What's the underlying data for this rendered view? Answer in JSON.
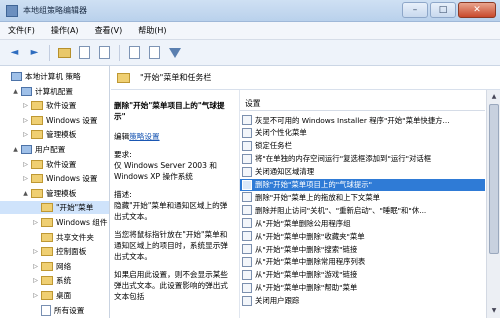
{
  "window": {
    "title": "本地组策略编辑器",
    "min": "–",
    "max": "□",
    "close": "✕"
  },
  "menu": [
    "文件(F)",
    "操作(A)",
    "查看(V)",
    "帮助(H)"
  ],
  "toolbar": {
    "back": "◄",
    "forward": "►"
  },
  "tree": [
    {
      "label": "本地计算机 策略",
      "indent": 0,
      "twisty": "",
      "icon": "computer"
    },
    {
      "label": "计算机配置",
      "indent": 1,
      "twisty": "▲",
      "icon": "computer"
    },
    {
      "label": "软件设置",
      "indent": 2,
      "twisty": "▷",
      "icon": "folder"
    },
    {
      "label": "Windows 设置",
      "indent": 2,
      "twisty": "▷",
      "icon": "folder"
    },
    {
      "label": "管理模板",
      "indent": 2,
      "twisty": "▷",
      "icon": "folder"
    },
    {
      "label": "用户配置",
      "indent": 1,
      "twisty": "▲",
      "icon": "computer"
    },
    {
      "label": "软件设置",
      "indent": 2,
      "twisty": "▷",
      "icon": "folder"
    },
    {
      "label": "Windows 设置",
      "indent": 2,
      "twisty": "▷",
      "icon": "folder"
    },
    {
      "label": "管理模板",
      "indent": 2,
      "twisty": "▲",
      "icon": "folder"
    },
    {
      "label": "\"开始\"菜单",
      "indent": 3,
      "twisty": "",
      "icon": "folder",
      "selected": true
    },
    {
      "label": "Windows 组件",
      "indent": 3,
      "twisty": "▷",
      "icon": "folder"
    },
    {
      "label": "共享文件夹",
      "indent": 3,
      "twisty": "",
      "icon": "folder"
    },
    {
      "label": "控制面板",
      "indent": 3,
      "twisty": "▷",
      "icon": "folder"
    },
    {
      "label": "网络",
      "indent": 3,
      "twisty": "▷",
      "icon": "folder"
    },
    {
      "label": "系统",
      "indent": 3,
      "twisty": "▷",
      "icon": "folder"
    },
    {
      "label": "桌面",
      "indent": 3,
      "twisty": "▷",
      "icon": "folder"
    },
    {
      "label": "所有设置",
      "indent": 3,
      "twisty": "",
      "icon": "doc"
    }
  ],
  "main": {
    "header": "\"开始\"菜单和任务栏",
    "description": {
      "heading": "删除\"开始\"菜单项目上的\"气球提示\"",
      "edit_link": "策略设置",
      "edit_prefix": "编辑",
      "requirements": "要求:\n仅 Windows Server 2003 和 Windows XP 操作系统",
      "desc": "描述:\n隐藏\"开始\"菜单和通知区域上的弹出式文本。",
      "detail1": "当您将鼠标指针放在\"开始\"菜单和通知区域上的项目时，系统显示弹出式文本。",
      "detail2": "如果启用此设置，则不会显示某些弹出式文本。此设置影响的弹出式文本包括"
    },
    "column": "设置",
    "rows": [
      "灰显不可用的 Windows Installer 程序\"开始\"菜单快捷方...",
      "关闭个性化菜单",
      "锁定任务栏",
      "将\"在单独的内存空间运行\"复选框添加到\"运行\"对话框",
      "关闭通知区域清理",
      "删除\"开始\"菜单项目上的\"气球提示\"",
      "删除\"开始\"菜单上的拖放和上下文菜单",
      "删除并阻止访问\"关机\"、\"重新启动\"、\"睡眠\"和\"休...",
      "从\"开始\"菜单删除公用程序组",
      "从\"开始\"菜单中删除\"收藏夹\"菜单",
      "从\"开始\"菜单中删除\"搜索\"链接",
      "从\"开始\"菜单中删除常用程序列表",
      "从\"开始\"菜单中删除\"游戏\"链接",
      "从\"开始\"菜单中删除\"帮助\"菜单",
      "关闭用户跟踪"
    ],
    "selected_row": 5
  }
}
